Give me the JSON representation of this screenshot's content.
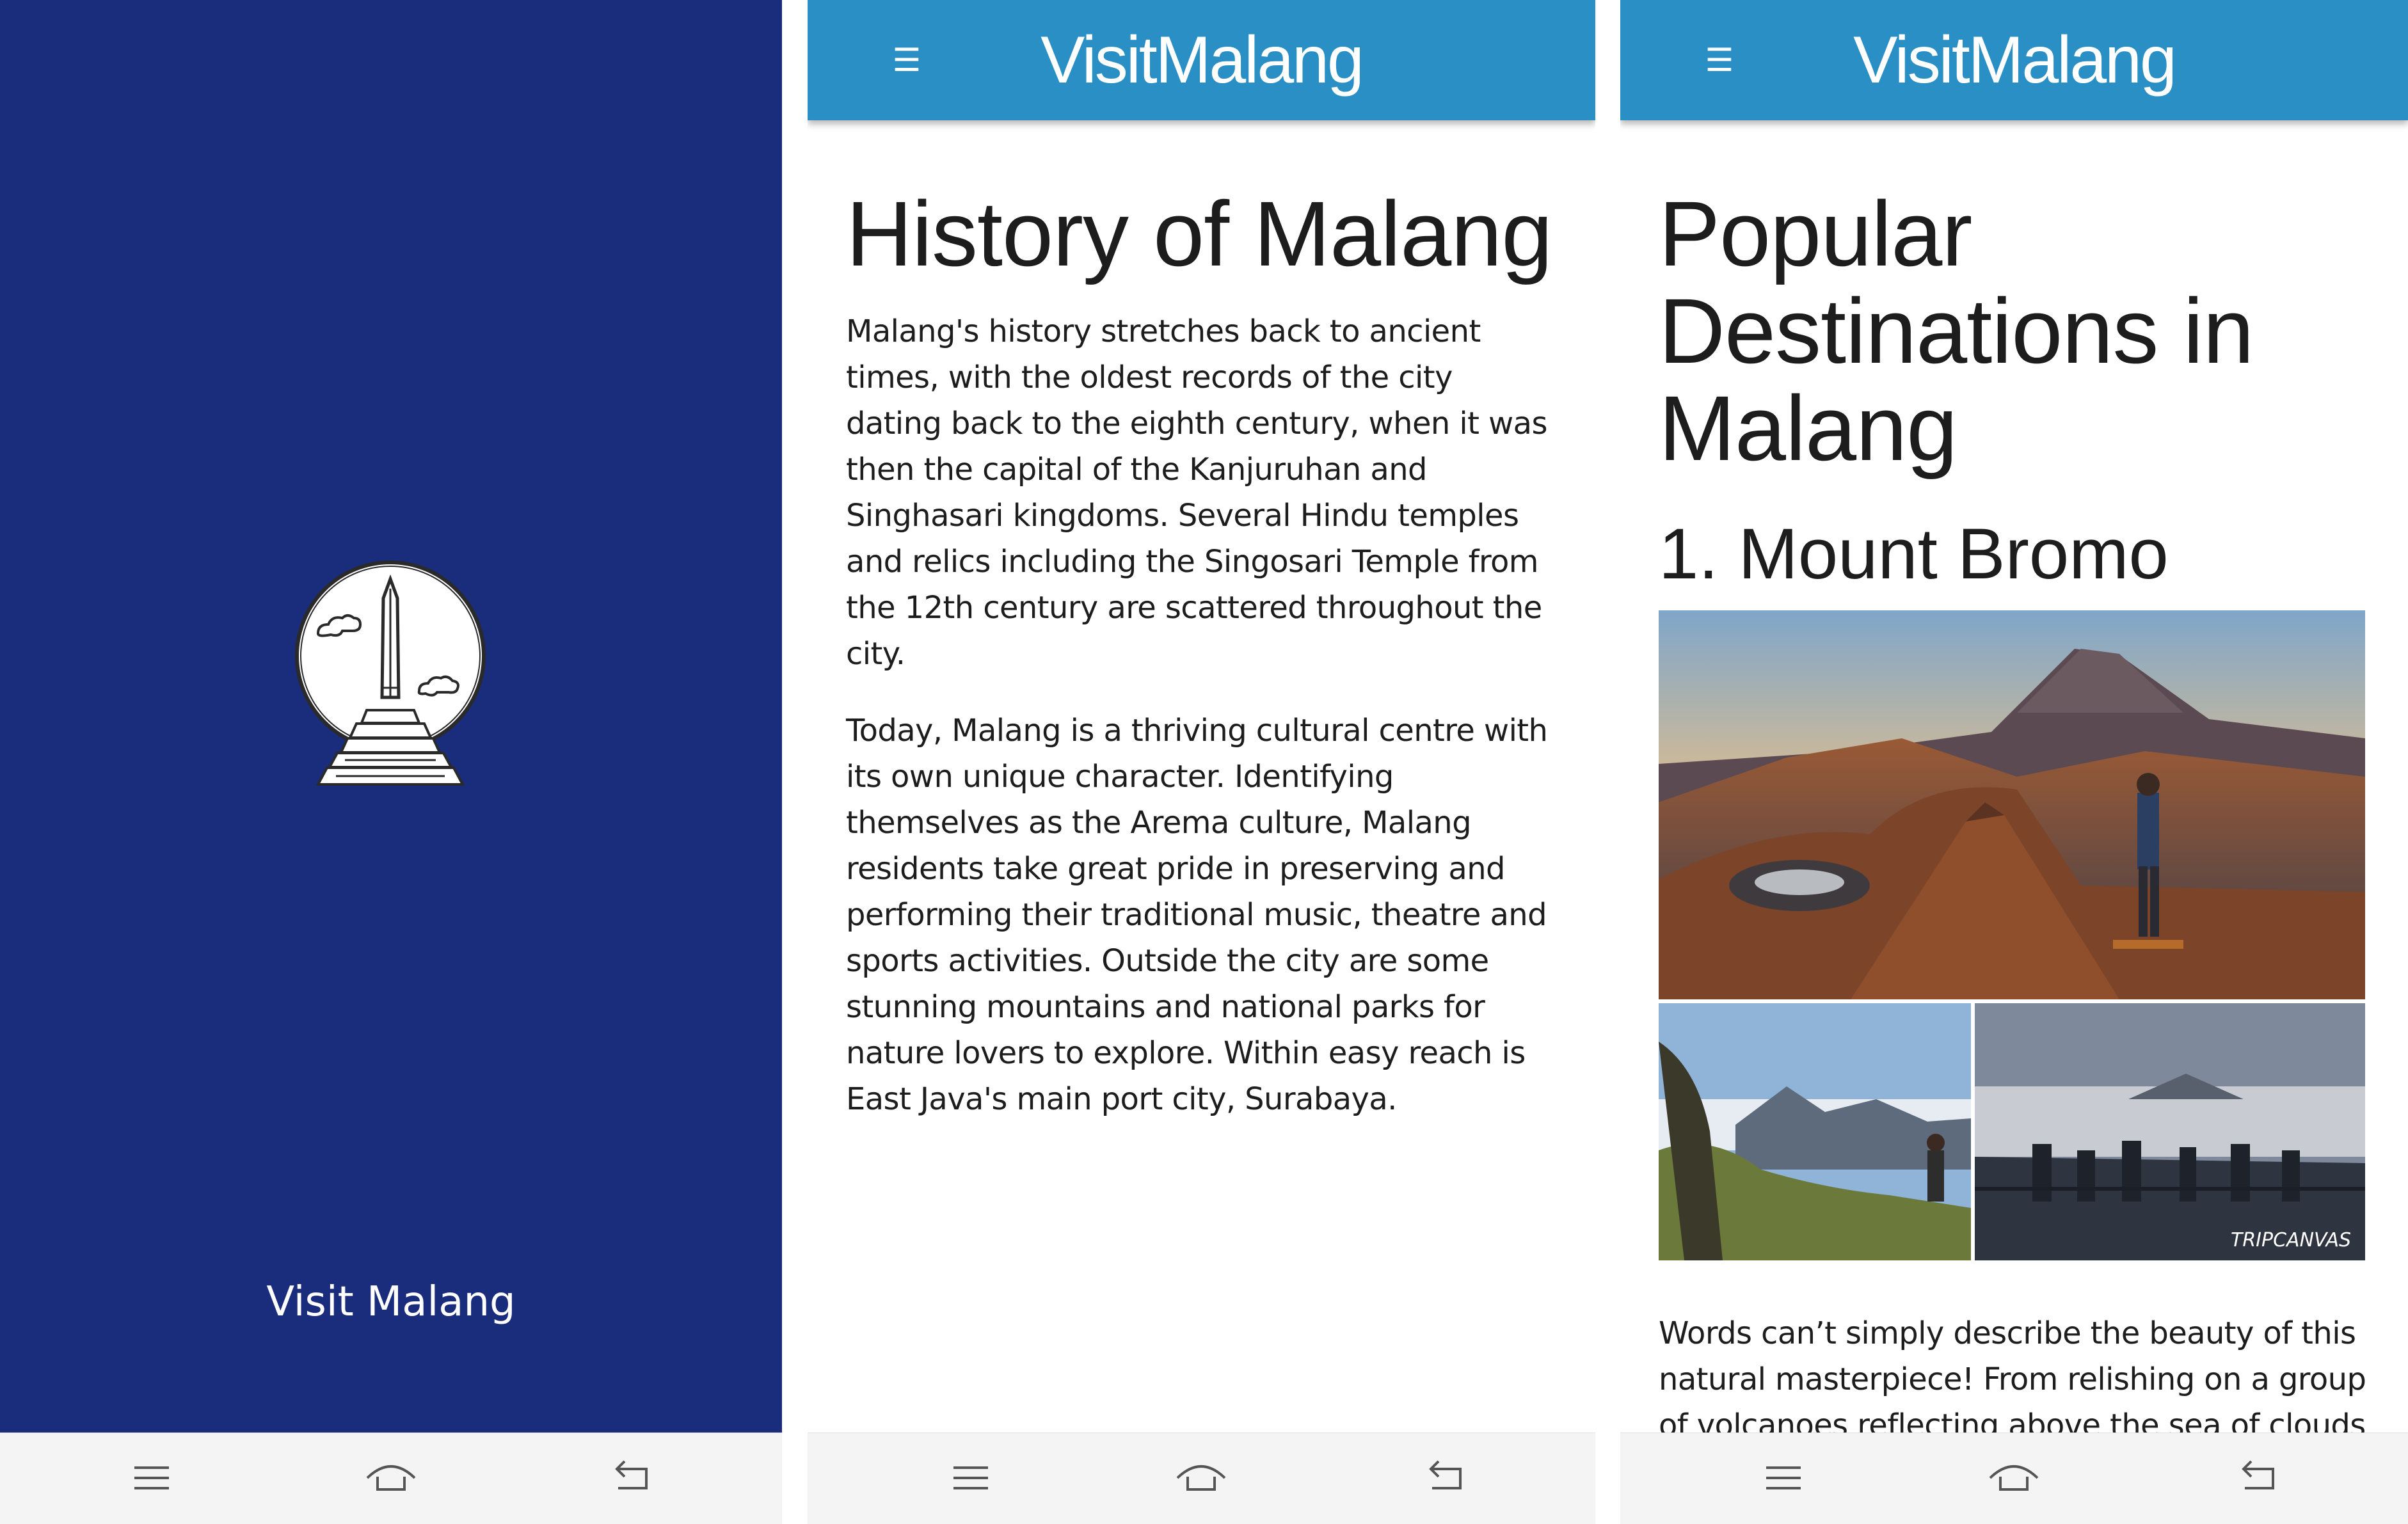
{
  "splash": {
    "title": "Visit Malang",
    "background": "#1a2d7c",
    "logo_icon": "malang-monument-logo"
  },
  "app_bar": {
    "title": "VisitMalang",
    "menu_icon": "☰",
    "background": "#2a8fc4"
  },
  "history": {
    "heading": "History of Malang",
    "paragraphs": [
      "Malang's history stretches back to ancient times, with the oldest records of the city dating back to the eighth century, when it was then the capital of the Kanjuruhan and Singhasari kingdoms. Several Hindu temples and relics including the Singosari Temple from the 12th century are scattered throughout the city.",
      "Today, Malang is a thriving cultural centre with its own unique character. Identifying themselves as the Arema culture, Malang residents take great pride in preserving and performing their traditional music, theatre and sports activities. Outside the city are some stunning mountains and national parks for nature lovers to explore. Within easy reach is East Java's main port city, Surabaya."
    ]
  },
  "destinations": {
    "heading": "Popular Destinations in Malang",
    "items": [
      {
        "title": "1. Mount Bromo",
        "image_watermark": "TRIPCANVAS",
        "description": "Words can’t simply describe the beauty of this natural masterpiece! From relishing on a group of volcanoes reflecting above the sea of clouds at"
      }
    ]
  },
  "nav_bar": {
    "icons": [
      "recent-apps-icon",
      "home-icon",
      "back-icon"
    ],
    "background": "#f4f4f4"
  }
}
